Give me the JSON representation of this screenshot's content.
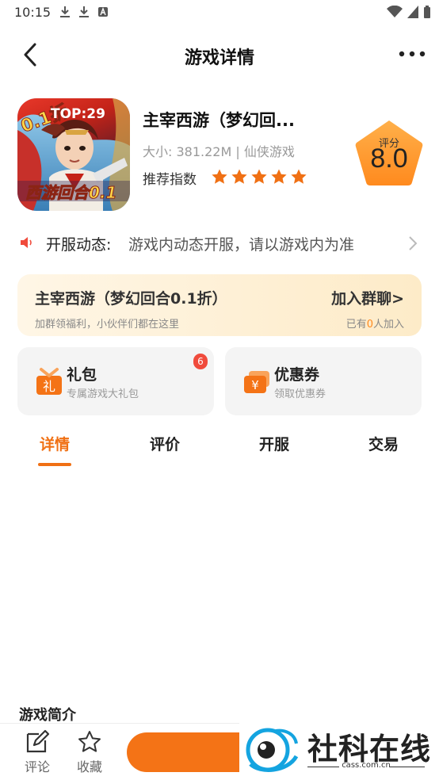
{
  "status_bar": {
    "time": "10:15"
  },
  "nav": {
    "title": "游戏详情"
  },
  "game": {
    "top_badge": "TOP:29",
    "title": "主宰西游（梦幻回...",
    "meta": "大小: 381.22M | 仙侠游戏",
    "recommend_label": "推荐指数",
    "recommend_stars": 5,
    "score_label": "评分",
    "score_value": "8.0"
  },
  "server": {
    "label": "开服动态:",
    "text": "游戏内动态开服，请以游戏内为准"
  },
  "group": {
    "title": "主宰西游（梦幻回合0.1折）",
    "subtitle": "加群领福利，小伙伴们都在这里",
    "join_label": "加入群聊>",
    "count_prefix": "已有",
    "count": "0",
    "count_suffix": "人加入"
  },
  "features": {
    "gift": {
      "title": "礼包",
      "subtitle": "专属游戏大礼包",
      "badge": "6",
      "icon_char": "礼"
    },
    "coupon": {
      "title": "优惠券",
      "subtitle": "领取优惠券",
      "icon_char": "¥"
    }
  },
  "tabs": [
    {
      "label": "详情",
      "active": true
    },
    {
      "label": "评价"
    },
    {
      "label": "开服"
    },
    {
      "label": "交易"
    }
  ],
  "intro": {
    "title": "游戏简介"
  },
  "bottom": {
    "comment_label": "评论",
    "favorite_label": "收藏"
  },
  "watermark": {
    "text": "社科在线",
    "url": "cass.com.cn"
  },
  "colors": {
    "accent": "#f07014",
    "score_badge": "#ff9a33",
    "star": "#f07014"
  }
}
